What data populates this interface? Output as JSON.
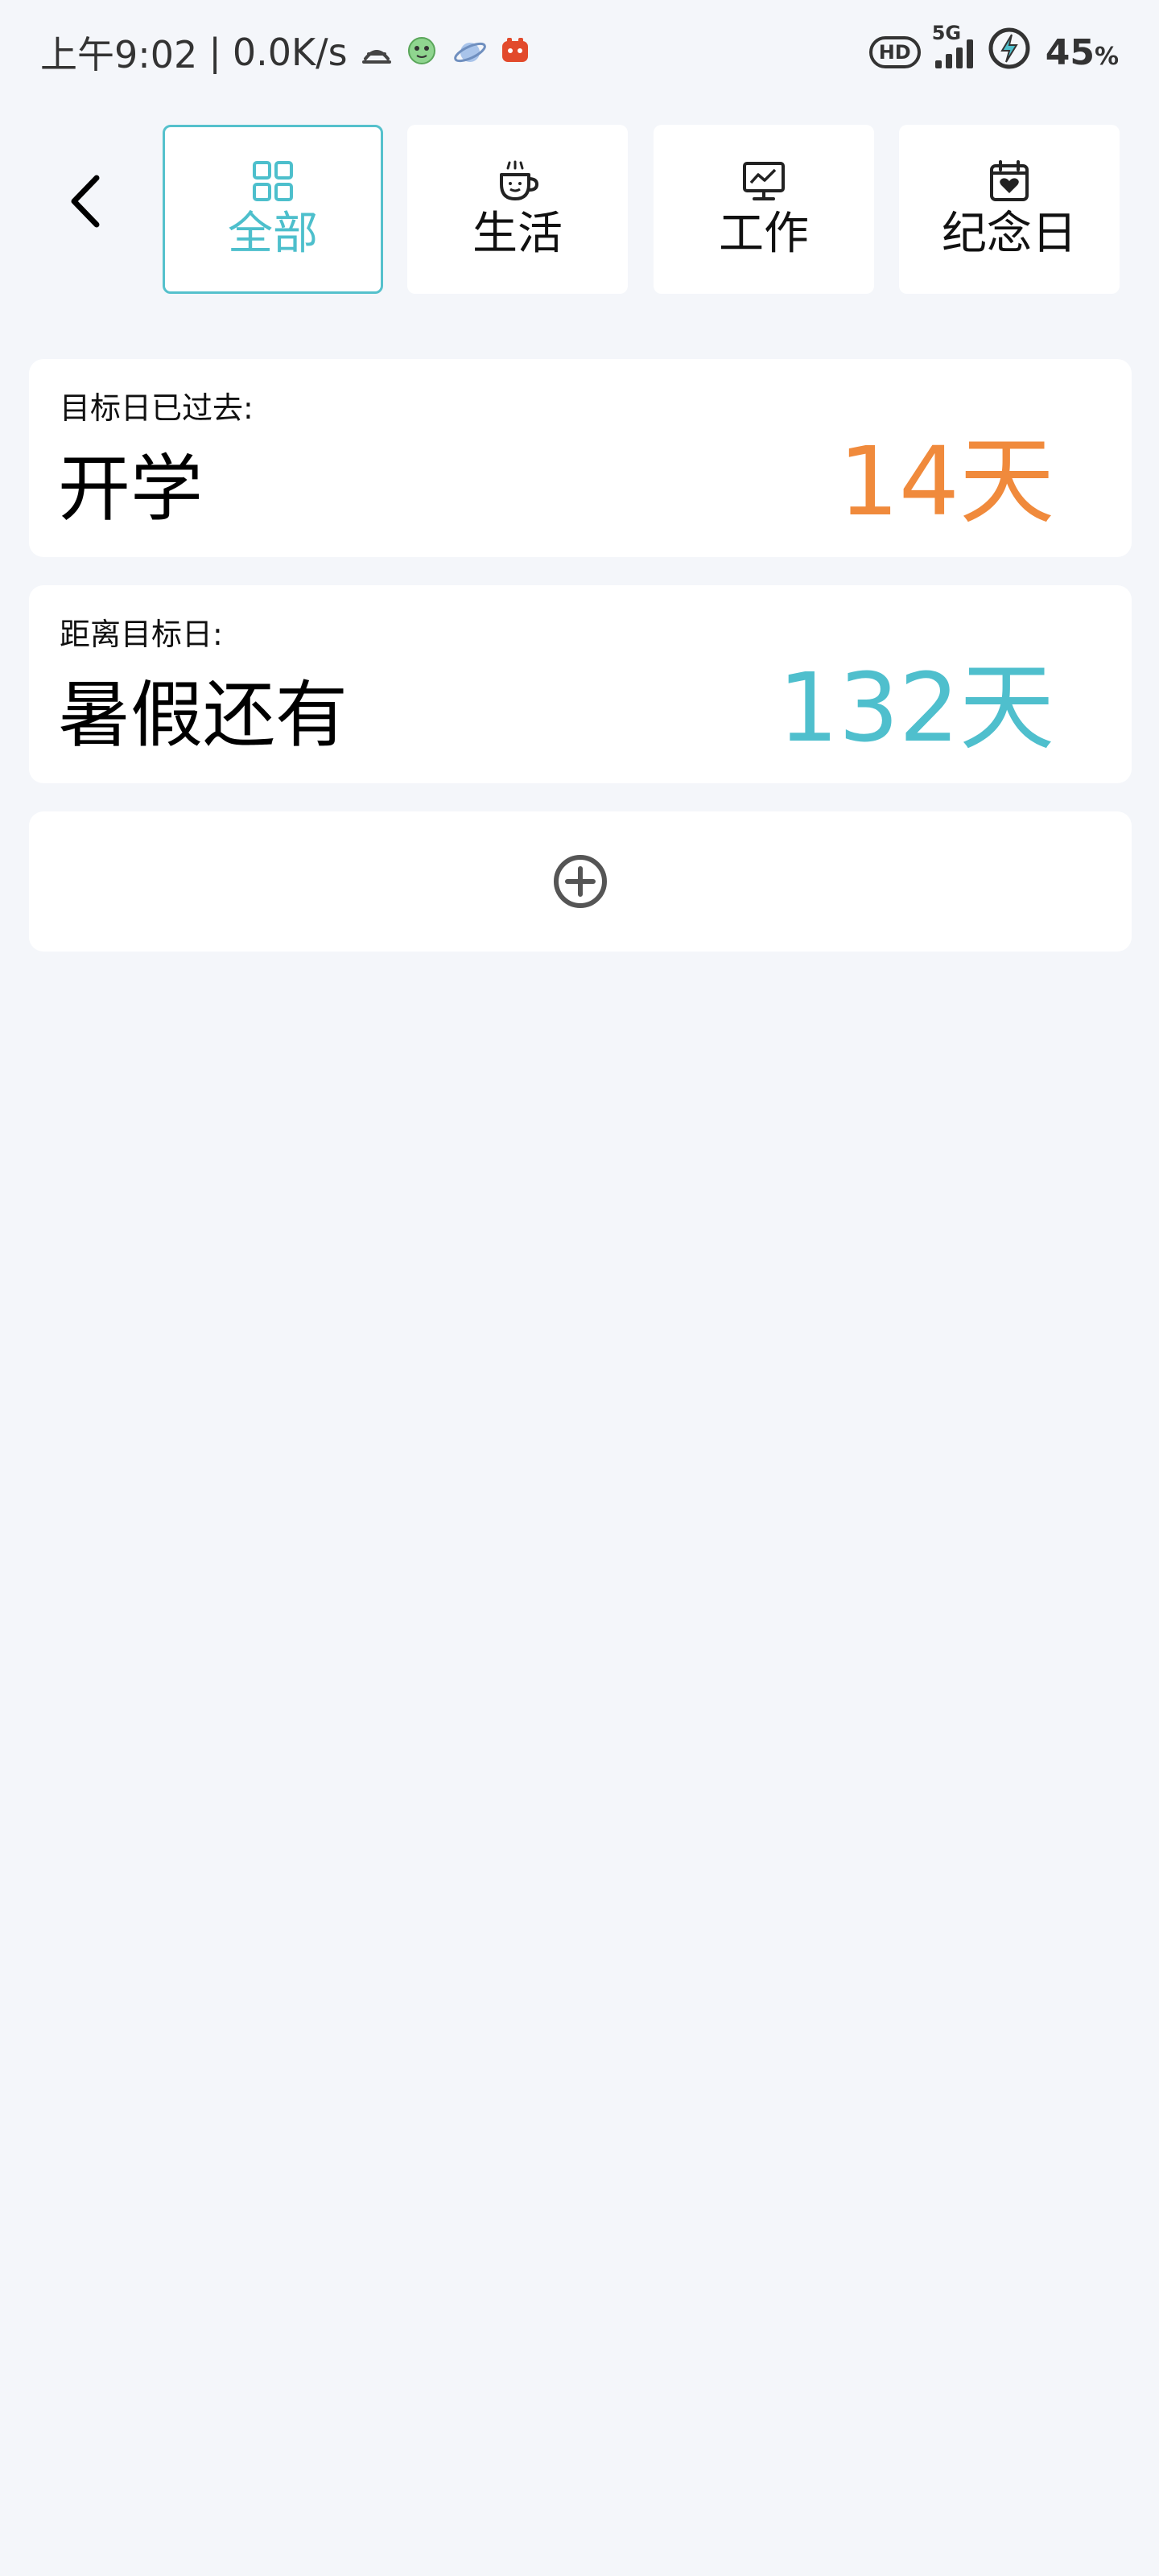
{
  "status_bar": {
    "time": "上午9:02",
    "separator": "|",
    "net_speed": "0.0K/s",
    "hd": "HD",
    "network": "5G",
    "battery_percent": "45",
    "percent_sign": "%"
  },
  "tabs": [
    {
      "label": "全部",
      "icon": "grid-icon",
      "active": true
    },
    {
      "label": "生活",
      "icon": "coffee-cup-icon",
      "active": false
    },
    {
      "label": "工作",
      "icon": "monitor-chart-icon",
      "active": false
    },
    {
      "label": "纪念日",
      "icon": "calendar-heart-icon",
      "active": false
    }
  ],
  "events": [
    {
      "subtitle": "目标日已过去:",
      "title": "开学",
      "days": "14天",
      "color": "#f08a3c"
    },
    {
      "subtitle": "距离目标日:",
      "title": "暑假还有",
      "days": "132天",
      "color": "#4fbfcd"
    }
  ],
  "colors": {
    "accent": "#4dbfcc",
    "past": "#f08a3c",
    "future": "#4fbfcd",
    "background": "#f4f6fa"
  }
}
